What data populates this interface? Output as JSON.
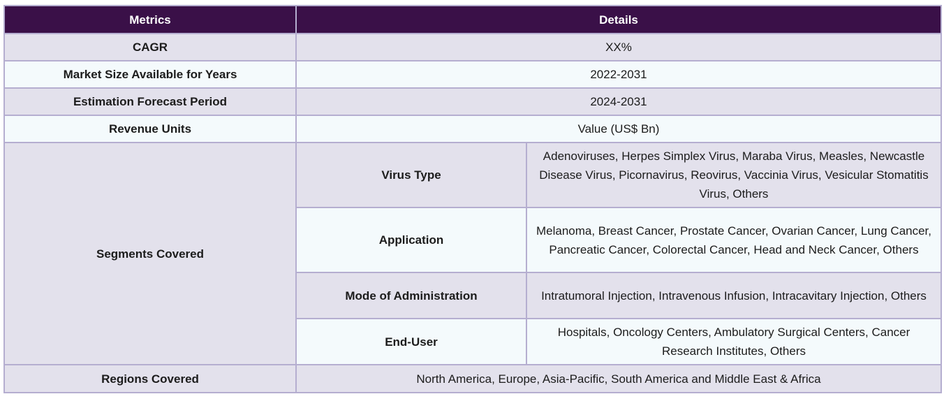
{
  "header": {
    "metrics": "Metrics",
    "details": "Details"
  },
  "rows": [
    {
      "label": "CAGR",
      "value": "XX%"
    },
    {
      "label": "Market Size Available for Years",
      "value": "2022-2031"
    },
    {
      "label": "Estimation Forecast Period",
      "value": "2024-2031"
    },
    {
      "label": "Revenue Units",
      "value": "Value (US$ Bn)"
    }
  ],
  "segments": {
    "label": "Segments Covered",
    "items": [
      {
        "name": "Virus Type",
        "value": "Adenoviruses, Herpes Simplex Virus, Maraba Virus, Measles, Newcastle Disease Virus, Picornavirus, Reovirus, Vaccinia Virus, Vesicular Stomatitis Virus, Others"
      },
      {
        "name": "Application",
        "value": "Melanoma, Breast Cancer, Prostate Cancer, Ovarian Cancer, Lung Cancer, Pancreatic Cancer, Colorectal Cancer, Head and Neck Cancer, Others"
      },
      {
        "name": "Mode of Administration",
        "value": "Intratumoral Injection, Intravenous Infusion, Intracavitary Injection, Others"
      },
      {
        "name": "End-User",
        "value": "Hospitals, Oncology Centers, Ambulatory Surgical Centers, Cancer Research Institutes, Others"
      }
    ]
  },
  "regions": {
    "label": "Regions Covered",
    "value": "North America, Europe, Asia-Pacific, South America and Middle East & Africa"
  }
}
